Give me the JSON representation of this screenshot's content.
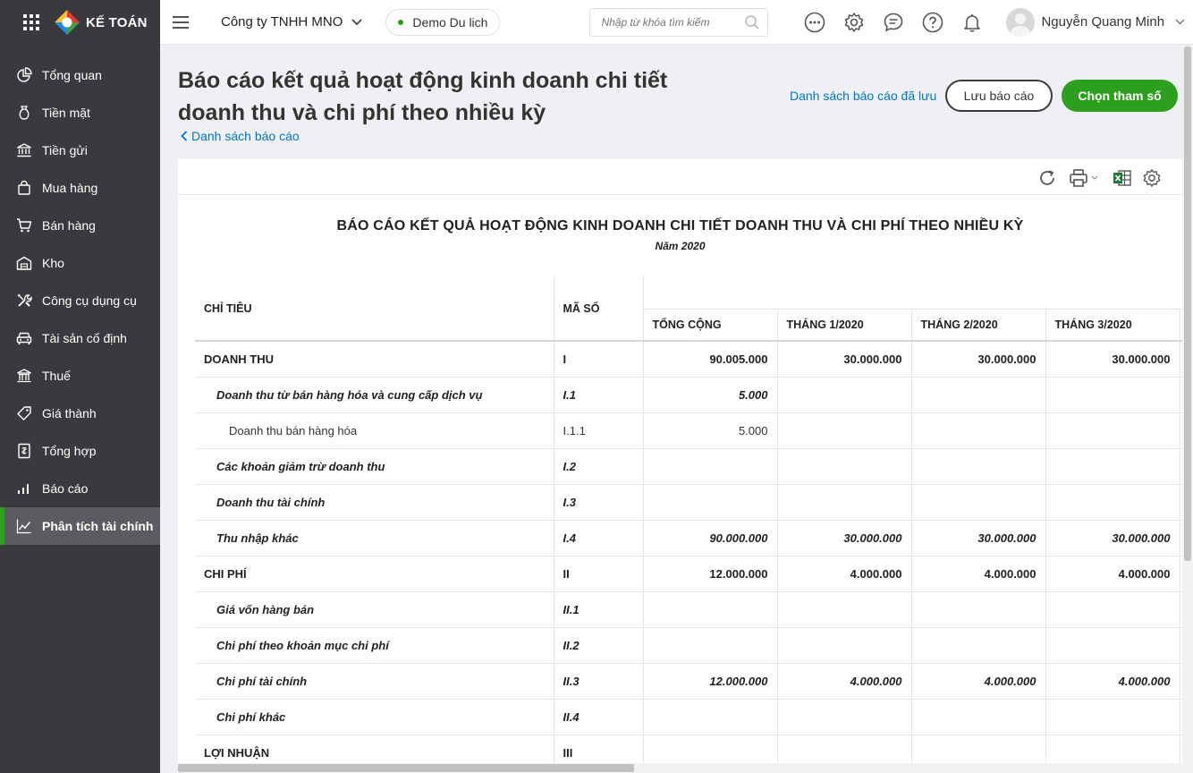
{
  "brand": {
    "name": "KẾ TOÁN"
  },
  "sidebar": {
    "items": [
      {
        "label": "Tổng quan",
        "icon": "chart-pie-icon"
      },
      {
        "label": "Tiền mặt",
        "icon": "money-bag-icon"
      },
      {
        "label": "Tiền gửi",
        "icon": "bank-icon"
      },
      {
        "label": "Mua hàng",
        "icon": "shopping-bag-icon"
      },
      {
        "label": "Bán hàng",
        "icon": "cart-icon"
      },
      {
        "label": "Kho",
        "icon": "warehouse-icon"
      },
      {
        "label": "Công cụ dụng cụ",
        "icon": "tools-icon"
      },
      {
        "label": "Tài sản cố định",
        "icon": "car-icon"
      },
      {
        "label": "Thuế",
        "icon": "government-icon"
      },
      {
        "label": "Giá thành",
        "icon": "price-tag-icon"
      },
      {
        "label": "Tổng hợp",
        "icon": "ledger-icon"
      },
      {
        "label": "Báo cáo",
        "icon": "bar-chart-icon"
      },
      {
        "label": "Phân tích tài chính",
        "icon": "line-chart-icon",
        "active": true
      }
    ]
  },
  "topbar": {
    "company": "Công ty TNHH MNO",
    "demo": "Demo Du lich",
    "search_placeholder": "Nhập từ khóa tìm kiếm",
    "user_name": "Nguyễn Quang Minh"
  },
  "header": {
    "title_line1": "Báo cáo kết quả hoạt động kinh doanh chi tiết",
    "title_line2": "doanh thu và chi phí theo nhiều kỳ",
    "back_link": "Danh sách báo cáo",
    "saved_link": "Danh sách báo cáo đã lưu",
    "save_button": "Lưu báo cáo",
    "params_button": "Chọn tham số"
  },
  "report": {
    "title": "BÁO CÁO KẾT QUẢ HOẠT ĐỘNG KINH DOANH CHI TIẾT DOANH THU VÀ CHI PHÍ THEO NHIỀU KỲ",
    "subtitle": "Năm 2020",
    "columns": {
      "indicator": "CHỈ TIÊU",
      "code": "MÃ SỐ",
      "total": "TỔNG CỘNG",
      "m1": "THÁNG 1/2020",
      "m2": "THÁNG 2/2020",
      "m3": "THÁNG 3/2020"
    },
    "rows": [
      {
        "level": 0,
        "name": "DOANH THU",
        "code": "I",
        "total": "90.005.000",
        "m1": "30.000.000",
        "m2": "30.000.000",
        "m3": "30.000.000"
      },
      {
        "level": 1,
        "name": "Doanh thu từ bán hàng hóa và cung cấp dịch vụ",
        "code": "I.1",
        "total": "5.000",
        "m1": "",
        "m2": "",
        "m3": ""
      },
      {
        "level": 2,
        "name": "Doanh thu bán hàng hóa",
        "code": "I.1.1",
        "total": "5.000",
        "m1": "",
        "m2": "",
        "m3": ""
      },
      {
        "level": 1,
        "name": "Các khoản giảm trừ doanh thu",
        "code": "I.2",
        "total": "",
        "m1": "",
        "m2": "",
        "m3": ""
      },
      {
        "level": 1,
        "name": "Doanh thu tài chính",
        "code": "I.3",
        "total": "",
        "m1": "",
        "m2": "",
        "m3": ""
      },
      {
        "level": 1,
        "name": "Thu nhập khác",
        "code": "I.4",
        "total": "90.000.000",
        "m1": "30.000.000",
        "m2": "30.000.000",
        "m3": "30.000.000"
      },
      {
        "level": 0,
        "name": "CHI PHÍ",
        "code": "II",
        "total": "12.000.000",
        "m1": "4.000.000",
        "m2": "4.000.000",
        "m3": "4.000.000"
      },
      {
        "level": 1,
        "name": "Giá vốn hàng bán",
        "code": "II.1",
        "total": "",
        "m1": "",
        "m2": "",
        "m3": ""
      },
      {
        "level": 1,
        "name": "Chi phí theo khoản mục chi phí",
        "code": "II.2",
        "total": "",
        "m1": "",
        "m2": "",
        "m3": ""
      },
      {
        "level": 1,
        "name": "Chi phí tài chính",
        "code": "II.3",
        "total": "12.000.000",
        "m1": "4.000.000",
        "m2": "4.000.000",
        "m3": "4.000.000"
      },
      {
        "level": 1,
        "name": "Chi phí khác",
        "code": "II.4",
        "total": "",
        "m1": "",
        "m2": "",
        "m3": ""
      },
      {
        "level": 0,
        "name": "LỢI NHUẬN",
        "code": "III",
        "total": "",
        "m1": "",
        "m2": "",
        "m3": ""
      }
    ]
  },
  "colors": {
    "accent": "#2ca01c",
    "sidebar": "#393a3d",
    "link": "#0077c5"
  }
}
